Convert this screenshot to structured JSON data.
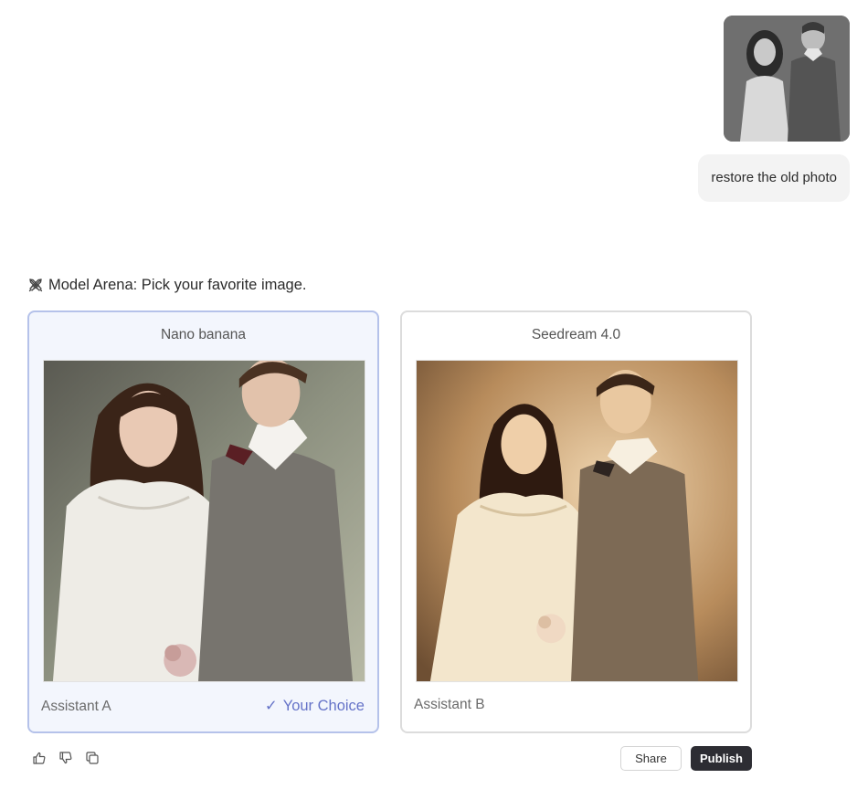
{
  "user_message": {
    "text": "restore the old photo",
    "attachment_icon": "photo-thumbnail"
  },
  "arena": {
    "icon": "crossed-swords-icon",
    "title": "Model Arena: Pick your favorite image.",
    "cards": [
      {
        "model": "Nano banana",
        "assistant": "Assistant A",
        "choice_label": "Your Choice",
        "selected": true
      },
      {
        "model": "Seedream 4.0",
        "assistant": "Assistant B",
        "selected": false
      }
    ]
  },
  "actions": {
    "share_label": "Share",
    "publish_label": "Publish",
    "icons": [
      "thumbs-up-icon",
      "thumbs-down-icon",
      "copy-icon"
    ]
  },
  "colors": {
    "selected_border": "#b5c2ea",
    "selected_bg": "#f3f6fd",
    "choice_accent": "#6573c8",
    "publish_bg": "#2d2d33"
  }
}
